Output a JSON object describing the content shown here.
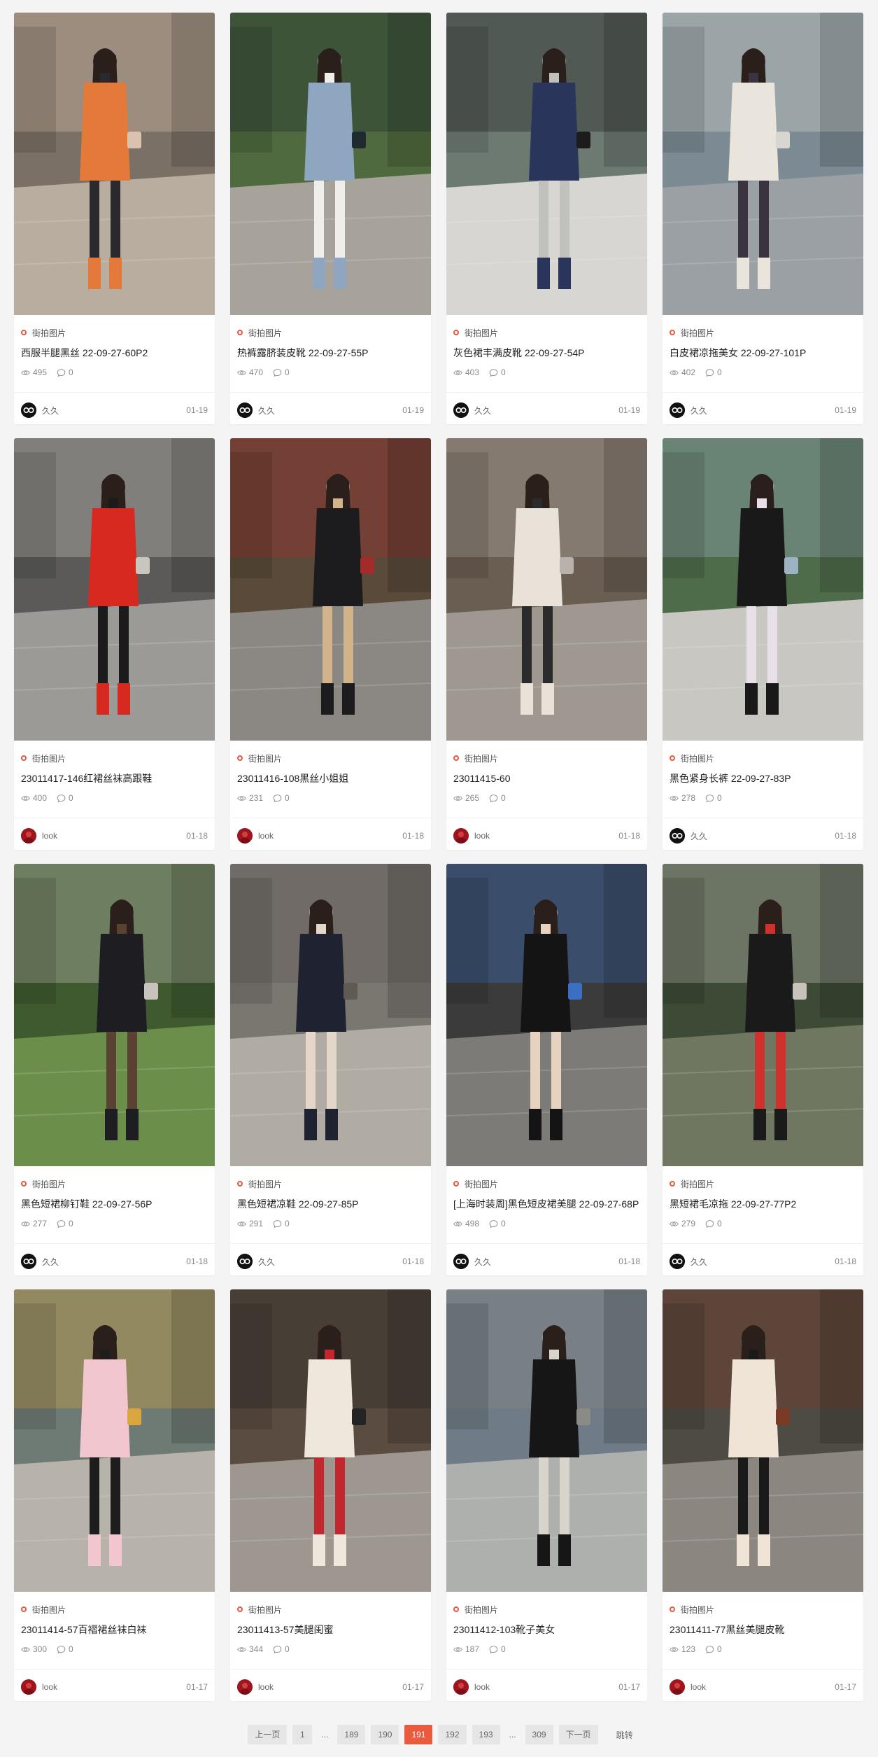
{
  "posts": [
    {
      "category": "街拍图片",
      "title": "西服半腿黑丝 22-09-27-60P2",
      "views": "495",
      "comments": "0",
      "author": "久久",
      "avatar": "jiujiu",
      "date": "01-19",
      "palette": [
        "#7b7065",
        "#b8ad9f",
        "#e37a3a",
        "#2a2a2e",
        "#d9c2b0"
      ]
    },
    {
      "category": "街拍图片",
      "title": "热裤露脐装皮靴 22-09-27-55P",
      "views": "470",
      "comments": "0",
      "author": "久久",
      "avatar": "jiujiu",
      "date": "01-19",
      "palette": [
        "#4f6a3e",
        "#a7a39b",
        "#8fa6c1",
        "#f0eeea",
        "#1f2a30"
      ]
    },
    {
      "category": "街拍图片",
      "title": "灰色裙丰满皮靴 22-09-27-54P",
      "views": "403",
      "comments": "0",
      "author": "久久",
      "avatar": "jiujiu",
      "date": "01-19",
      "palette": [
        "#6d7a72",
        "#d7d6d2",
        "#2a355c",
        "#c0c0bc",
        "#1c1c1c"
      ]
    },
    {
      "category": "街拍图片",
      "title": "白皮裙凉拖美女 22-09-27-101P",
      "views": "402",
      "comments": "0",
      "author": "久久",
      "avatar": "jiujiu",
      "date": "01-19",
      "palette": [
        "#7c8a93",
        "#9aa0a4",
        "#e9e5dc",
        "#3a3340",
        "#d8d6d0"
      ]
    },
    {
      "category": "街拍图片",
      "title": "23011417-146红裙丝袜高跟鞋",
      "views": "400",
      "comments": "0",
      "author": "look",
      "avatar": "look",
      "date": "01-18",
      "palette": [
        "#5b5a58",
        "#9c9a96",
        "#d7291f",
        "#1b1b1b",
        "#c9c6c0"
      ]
    },
    {
      "category": "街拍图片",
      "title": "23011416-108黑丝小姐姐",
      "views": "231",
      "comments": "0",
      "author": "look",
      "avatar": "look",
      "date": "01-18",
      "palette": [
        "#5a4a3a",
        "#8b8782",
        "#1c1c1e",
        "#d2b48c",
        "#a52a2a"
      ]
    },
    {
      "category": "街拍图片",
      "title": "23011415-60",
      "views": "265",
      "comments": "0",
      "author": "look",
      "avatar": "look",
      "date": "01-18",
      "palette": [
        "#6a5d52",
        "#9f9891",
        "#e8e2d8",
        "#2b2b2b",
        "#b8b2aa"
      ]
    },
    {
      "category": "街拍图片",
      "title": "黑色紧身长裤 22-09-27-83P",
      "views": "278",
      "comments": "0",
      "author": "久久",
      "avatar": "jiujiu",
      "date": "01-18",
      "palette": [
        "#4e6b4a",
        "#c9c7c2",
        "#191919",
        "#e8e0e8",
        "#9eb3c2"
      ]
    },
    {
      "category": "街拍图片",
      "title": "黑色短裙柳钉鞋 22-09-27-56P",
      "views": "277",
      "comments": "0",
      "author": "久久",
      "avatar": "jiujiu",
      "date": "01-18",
      "palette": [
        "#3e5a2e",
        "#6b8f4a",
        "#1e1e22",
        "#5a4232",
        "#c8c4bc"
      ]
    },
    {
      "category": "街拍图片",
      "title": "黑色短裙凉鞋 22-09-27-85P",
      "views": "291",
      "comments": "0",
      "author": "久久",
      "avatar": "jiujiu",
      "date": "01-18",
      "palette": [
        "#7a7670",
        "#b0aca4",
        "#1f2230",
        "#e4d6c8",
        "#5f5a52"
      ]
    },
    {
      "category": "街拍图片",
      "title": "[上海时装周]黑色短皮裙美腿 22-09-27-68P",
      "views": "498",
      "comments": "0",
      "author": "久久",
      "avatar": "jiujiu",
      "date": "01-18",
      "palette": [
        "#3b3b3b",
        "#7d7b78",
        "#141414",
        "#e7d2c0",
        "#3a6fc4"
      ]
    },
    {
      "category": "街拍图片",
      "title": "黑短裙毛凉拖 22-09-27-77P2",
      "views": "279",
      "comments": "0",
      "author": "久久",
      "avatar": "jiujiu",
      "date": "01-18",
      "palette": [
        "#3d4a36",
        "#6f7760",
        "#1a1a1a",
        "#d0312d",
        "#c7c3bb"
      ]
    },
    {
      "category": "街拍图片",
      "title": "23011414-57百褶裙丝袜白袜",
      "views": "300",
      "comments": "0",
      "author": "look",
      "avatar": "look",
      "date": "01-17",
      "palette": [
        "#6e7a74",
        "#b7b2aa",
        "#f1c6cf",
        "#1d1d1d",
        "#d9a640"
      ]
    },
    {
      "category": "街拍图片",
      "title": "23011413-57美腿闺蜜",
      "views": "344",
      "comments": "0",
      "author": "look",
      "avatar": "look",
      "date": "01-17",
      "palette": [
        "#5a4c40",
        "#9d978f",
        "#efe6dc",
        "#c1272d",
        "#242424"
      ]
    },
    {
      "category": "街拍图片",
      "title": "23011412-103靴子美女",
      "views": "187",
      "comments": "0",
      "author": "look",
      "avatar": "look",
      "date": "01-17",
      "palette": [
        "#6f7b86",
        "#aeb0ae",
        "#161616",
        "#d8d4cc",
        "#8a8a86"
      ]
    },
    {
      "category": "街拍图片",
      "title": "23011411-77黑丝美腿皮靴",
      "views": "123",
      "comments": "0",
      "author": "look",
      "avatar": "look",
      "date": "01-17",
      "palette": [
        "#4e4a44",
        "#8b8680",
        "#efe4d6",
        "#1a1a1a",
        "#7a3b26"
      ]
    }
  ],
  "pagination": {
    "prev": "上一页",
    "first": "1",
    "ellipsis_left": "...",
    "p189": "189",
    "p190": "190",
    "current": "191",
    "p192": "192",
    "p193": "193",
    "ellipsis_right": "...",
    "last": "309",
    "next": "下一页",
    "jump": "跳转"
  },
  "colors": {
    "accent": "#ea5a3f",
    "category_dot": "#e8583c"
  }
}
